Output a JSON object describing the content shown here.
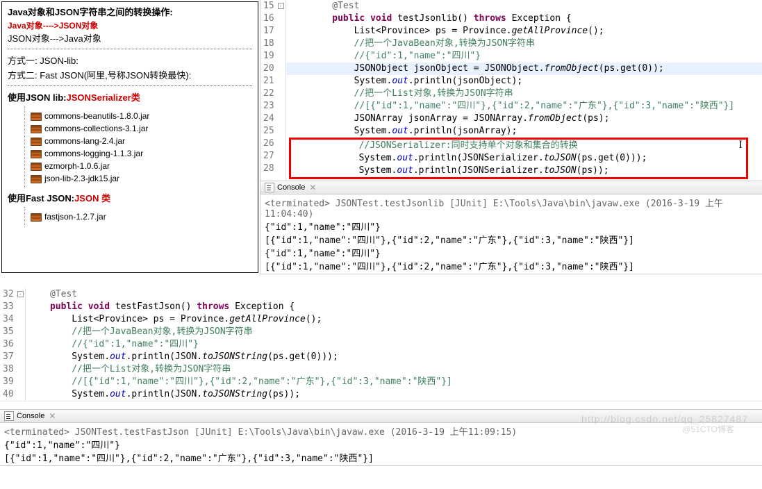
{
  "leftPanel": {
    "title": "Java对象和JSON字符串之间的转换操作:",
    "highlight": "Java对象---->JSON对象",
    "subtitle": "JSON对象--->Java对象",
    "method1": "方式一: JSON-lib:",
    "method2": "方式二: Fast JSON(阿里,号称JSON转换最快):",
    "section1": "使用JSON lib:",
    "section1red": "JSONSerializer类",
    "section2": "使用Fast JSON:",
    "section2red": "JSON 类",
    "jars1": [
      "commons-beanutils-1.8.0.jar",
      "commons-collections-3.1.jar",
      "commons-lang-2.4.jar",
      "commons-logging-1.1.3.jar",
      "ezmorph-1.0.6.jar",
      "json-lib-2.3-jdk15.jar"
    ],
    "jars2": [
      "fastjson-1.2.7.jar"
    ]
  },
  "editor1": {
    "lines": [
      {
        "n": "15",
        "fold": true
      },
      {
        "n": "16"
      },
      {
        "n": "17"
      },
      {
        "n": "18"
      },
      {
        "n": "19"
      },
      {
        "n": "20",
        "hl": true
      },
      {
        "n": "21"
      },
      {
        "n": "22"
      },
      {
        "n": "23"
      },
      {
        "n": "24"
      },
      {
        "n": "25"
      },
      {
        "n": "26"
      },
      {
        "n": "27"
      },
      {
        "n": "28"
      }
    ],
    "code": {
      "l15": "@Test",
      "l16a": "public void",
      "l16b": " testJsonlib() ",
      "l16c": "throws",
      "l16d": " Exception {",
      "l17a": "List<Province> ps = Province.",
      "l17b": "getAllProvince",
      "l17c": "();",
      "l18": "//把一个JavaBean对象,转换为JSON字符串",
      "l19": "//{\"id\":1,\"name\":\"四川\"}",
      "l20a": "JSONObject jsonObject = JSONObject.",
      "l20b": "fromObject",
      "l20c": "(ps.get(0));",
      "l21a": "System.",
      "l21b": "out",
      "l21c": ".println(jsonObject);",
      "l22": "//把一个List对象,转换为JSON字符串",
      "l23": "//[{\"id\":1,\"name\":\"四川\"},{\"id\":2,\"name\":\"广东\"},{\"id\":3,\"name\":\"陕西\"}]",
      "l24a": "JSONArray jsonArray = JSONArray.",
      "l24b": "fromObject",
      "l24c": "(ps);",
      "l25a": "System.",
      "l25b": "out",
      "l25c": ".println(jsonArray);",
      "l26": "//JSONSerializer:同时支持单个对象和集合的转换",
      "l27a": "System.",
      "l27b": "out",
      "l27c": ".println(JSONSerializer.",
      "l27d": "toJSON",
      "l27e": "(ps.get(0)));",
      "l28a": "System.",
      "l28b": "out",
      "l28c": ".println(JSONSerializer.",
      "l28d": "toJSON",
      "l28e": "(ps));"
    }
  },
  "console1": {
    "title": "Console",
    "status": "<terminated> JSONTest.testJsonlib [JUnit] E:\\Tools\\Java\\bin\\javaw.exe (2016-3-19 上午11:04:40)",
    "output": [
      "{\"id\":1,\"name\":\"四川\"}",
      "[{\"id\":1,\"name\":\"四川\"},{\"id\":2,\"name\":\"广东\"},{\"id\":3,\"name\":\"陕西\"}]",
      "{\"id\":1,\"name\":\"四川\"}",
      "[{\"id\":1,\"name\":\"四川\"},{\"id\":2,\"name\":\"广东\"},{\"id\":3,\"name\":\"陕西\"}]"
    ]
  },
  "editor2": {
    "lines": [
      {
        "n": "32",
        "fold": true
      },
      {
        "n": "33"
      },
      {
        "n": "34"
      },
      {
        "n": "35"
      },
      {
        "n": "36"
      },
      {
        "n": "37"
      },
      {
        "n": "38"
      },
      {
        "n": "39"
      },
      {
        "n": "40"
      }
    ],
    "code": {
      "l32": "@Test",
      "l33a": "public void",
      "l33b": " testFastJson() ",
      "l33c": "throws",
      "l33d": " Exception {",
      "l34a": "List<Province> ps = Province.",
      "l34b": "getAllProvince",
      "l34c": "();",
      "l35": "//把一个JavaBean对象,转换为JSON字符串",
      "l36": "//{\"id\":1,\"name\":\"四川\"}",
      "l37a": "System.",
      "l37b": "out",
      "l37c": ".println(JSON.",
      "l37d": "toJSONString",
      "l37e": "(ps.get(0)));",
      "l38": "//把一个List对象,转换为JSON字符串",
      "l39": "//[{\"id\":1,\"name\":\"四川\"},{\"id\":2,\"name\":\"广东\"},{\"id\":3,\"name\":\"陕西\"}]",
      "l40a": "System.",
      "l40b": "out",
      "l40c": ".println(JSON.",
      "l40d": "toJSONString",
      "l40e": "(ps));"
    }
  },
  "console2": {
    "title": "Console",
    "status": "<terminated> JSONTest.testFastJson [JUnit] E:\\Tools\\Java\\bin\\javaw.exe (2016-3-19 上午11:09:15)",
    "output": [
      "{\"id\":1,\"name\":\"四川\"}",
      "[{\"id\":1,\"name\":\"四川\"},{\"id\":2,\"name\":\"广东\"},{\"id\":3,\"name\":\"陕西\"}]"
    ]
  },
  "watermark": "http://blog.csdn.net/qq_25827487",
  "watermark2": "@51CTO博客"
}
